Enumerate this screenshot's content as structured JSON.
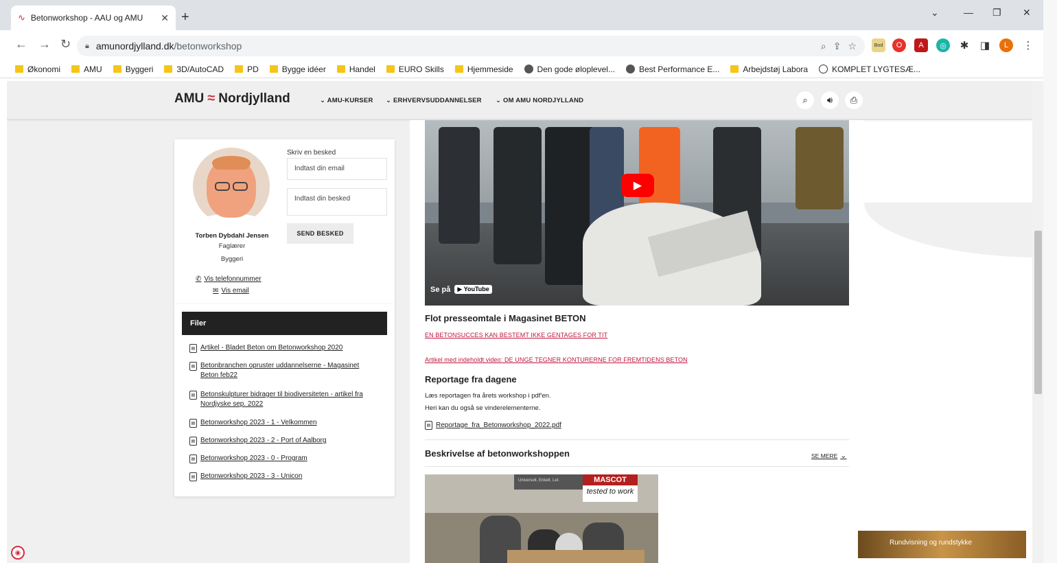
{
  "browser": {
    "tab_title": "Betonworkshop - AAU og AMU",
    "url_host": "amunordjylland.dk",
    "url_path": "/betonworkshop",
    "bookmarks": [
      "Økonomi",
      "AMU",
      "Byggeri",
      "3D/AutoCAD",
      "PD",
      "Bygge idéer",
      "Handel",
      "EURO Skills",
      "Hjemmeside",
      "Den gode øloplevel...",
      "Best Performance E...",
      "Arbejdstøj Labora",
      "KOMPLET LYGTESÆ..."
    ],
    "profile_initial": "L",
    "ext_bod": "Bod"
  },
  "site": {
    "logo_amu": "AMU",
    "logo_name": "Nordjylland",
    "menu": [
      "AMU-KURSER",
      "ERHVERVSUDDANNELSER",
      "OM AMU NORDJYLLAND"
    ]
  },
  "contact": {
    "name": "Torben Dybdahl Jensen",
    "title": "Faglærer",
    "department": "Byggeri",
    "phone_link": "Vis telefonnummer",
    "email_link": "Vis email",
    "form_label": "Skriv en besked",
    "email_placeholder": "Indtast din email",
    "message_placeholder": "Indtast din besked",
    "send_label": "SEND BESKED"
  },
  "files": {
    "heading": "Filer",
    "items": [
      "Artikel - Bladet Beton om Betonworkshop 2020",
      "Betonbranchen opruster uddannelserne - Magasinet Beton feb22",
      "Betonskulpturer bidrager til biodiversiteten - artikel fra Nordjyske sep. 2022",
      "Betonworkshop 2023 - 1 - Velkommen",
      "Betonworkshop 2023 - 2 - Port of Aalborg",
      "Betonworkshop 2023 - 0 - Program",
      "Betonworkshop 2023 - 3 - Unicon"
    ]
  },
  "main": {
    "video_watch": "Se på",
    "video_brand": "YouTube",
    "press_heading": "Flot presseomtale i Magasinet BETON",
    "press_link1": "EN BETONSUCCES KAN BESTEMT IKKE GENTAGES FOR TIT",
    "press_link2": "Artikel med indeholdt video: DE UNGE TEGNER KONTURERNE FOR FREMTIDENS BETON",
    "report_heading": "Reportage fra dagene",
    "report_text1": "Læs reportagen fra årets workshop i pdf'en.",
    "report_text2": "Heri kan du også se vinderelementerne.",
    "report_pdf": "Reportage_fra_Betonworkshop_2022.pdf",
    "desc_heading": "Beskrivelse af betonworkshoppen",
    "see_more": "SE MERE",
    "photo_mascot": "MASCOT",
    "photo_tagline": "tested to work",
    "photo_sign": "Universelt. Enkelt. Let."
  },
  "toast": "Rundvisning og rundstykke"
}
